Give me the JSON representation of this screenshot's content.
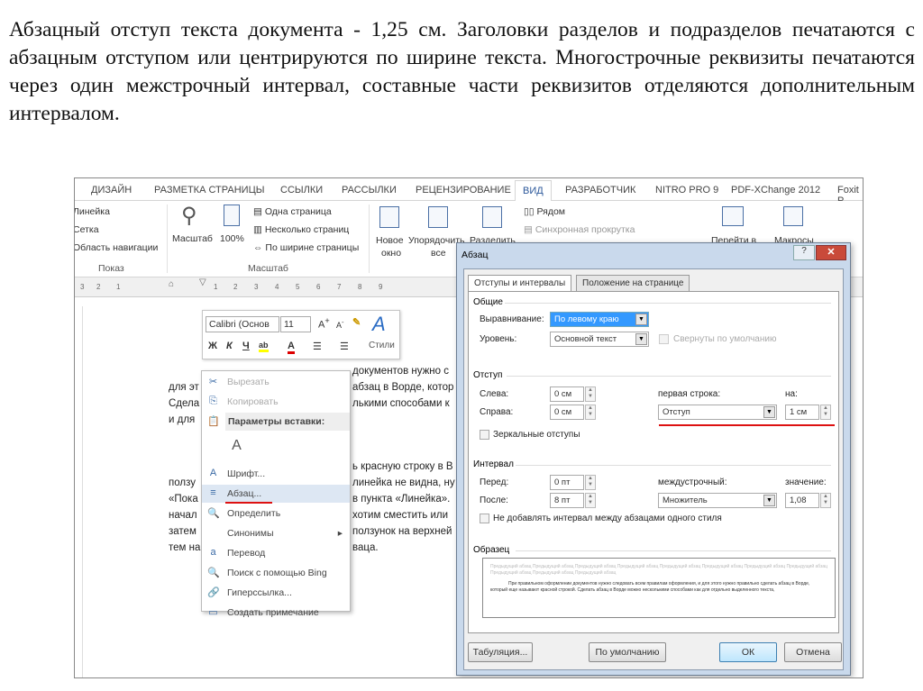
{
  "intro_text": "Абзацный отступ текста документа - 1,25 см. Заголовки разделов и подразделов печатаются с абзацным отступом или центрируются по ширине текста. Многострочные реквизиты печатаются через один межстрочный интервал, составные части реквизитов отделяются дополнительным интервалом.",
  "ribbon": {
    "tabs": [
      "ДИЗАЙН",
      "РАЗМЕТКА СТРАНИЦЫ",
      "ССЫЛКИ",
      "РАССЫЛКИ",
      "РЕЦЕНЗИРОВАНИЕ",
      "ВИД",
      "РАЗРАБОТЧИК",
      "NITRO PRO 9",
      "PDF-XChange 2012",
      "Foxit P"
    ],
    "active_tab": "ВИД",
    "show": {
      "items": [
        "Линейка",
        "Сетка",
        "Область навигации"
      ],
      "group": "Показ"
    },
    "zoom": {
      "zoom": "Масштаб",
      "percent": "100%",
      "one_page": "Одна страница",
      "multi_page": "Несколько страниц",
      "page_width": "По ширине страницы",
      "group": "Масштаб"
    },
    "window": {
      "new_window": "Новое",
      "new_window2": "окно",
      "arrange": "Упорядочить",
      "arrange2": "все",
      "split": "Разделить",
      "side_by_side": "Рядом",
      "sync_scroll": "Синхронная прокрутка",
      "switch": "Перейти в",
      "macros": "Макросы"
    }
  },
  "ruler": [
    "3",
    "2",
    "1",
    "1",
    "2",
    "3",
    "4",
    "5",
    "6",
    "7",
    "8",
    "9"
  ],
  "document": {
    "lines": [
      {
        "left": "",
        "right": "документов нужно с"
      },
      {
        "left": "для эт",
        "right": "абзац в Ворде, котор"
      },
      {
        "left": "Сдела",
        "right": "лькими способами к"
      },
      {
        "left": "и для",
        "right": ""
      },
      {
        "left": "",
        "right": "ь красную строку в В"
      },
      {
        "left": "ползу",
        "right": "линейка не видна, ну"
      },
      {
        "left": "«Пока",
        "right": "в пункта «Линейка»."
      },
      {
        "left": "начал",
        "right": "хотим сместить или"
      },
      {
        "left": "затем",
        "right": "ползунок на верхней"
      },
      {
        "left": "тем на",
        "right": "ваца."
      }
    ]
  },
  "mini_toolbar": {
    "font": "Calibri (Основ",
    "size": "11",
    "bold": "Ж",
    "italic": "К",
    "underline": "Ч",
    "styles": "Стили"
  },
  "context_menu": [
    {
      "label": "Вырезать",
      "icon": "✂",
      "state": "disabled"
    },
    {
      "label": "Копировать",
      "icon": "⎘",
      "state": "disabled"
    },
    {
      "label": "Параметры вставки:",
      "icon": "📋",
      "state": "header"
    },
    {
      "label": "",
      "icon": "A",
      "state": "paste"
    },
    {
      "label": "Шрифт...",
      "icon": "A",
      "state": ""
    },
    {
      "label": "Абзац...",
      "icon": "≡",
      "state": "highlight"
    },
    {
      "label": "Определить",
      "icon": "🔍",
      "state": ""
    },
    {
      "label": "Синонимы",
      "icon": "",
      "state": "submenu"
    },
    {
      "label": "Перевод",
      "icon": "a",
      "state": ""
    },
    {
      "label": "Поиск с помощью Bing",
      "icon": "🔍",
      "state": ""
    },
    {
      "label": "Гиперссылка...",
      "icon": "🔗",
      "state": ""
    },
    {
      "label": "Создать примечание",
      "icon": "▭",
      "state": ""
    }
  ],
  "dialog": {
    "title": "Абзац",
    "help": "?",
    "close": "✕",
    "tabs": [
      "Отступы и интервалы",
      "Положение на странице"
    ],
    "general": {
      "title": "Общие",
      "alignment_label": "Выравнивание:",
      "alignment": "По левому краю",
      "level_label": "Уровень:",
      "level": "Основной текст",
      "collapsed": "Свернуты по умолчанию"
    },
    "indent": {
      "title": "Отступ",
      "left_label": "Слева:",
      "left": "0 см",
      "right_label": "Справа:",
      "right": "0 см",
      "first_label": "первая строка:",
      "first": "Отступ",
      "by_label": "на:",
      "by": "1 см",
      "mirror": "Зеркальные отступы"
    },
    "spacing": {
      "title": "Интервал",
      "before_label": "Перед:",
      "before": "0 пт",
      "after_label": "После:",
      "after": "8 пт",
      "line_label": "междустрочный:",
      "line": "Множитель",
      "value_label": "значение:",
      "value": "1,08",
      "no_add": "Не добавлять интервал между абзацами одного стиля"
    },
    "preview": {
      "title": "Образец",
      "prev": "Предыдущий абзац Предыдущий абзац Предыдущий абзац Предыдущий абзац Предыдущий абзац Предыдущий абзац Предыдущий абзац Предыдущий абзац Предыдущий абзац Предыдущий абзац Предыдущий абзац",
      "sample": "При правильном оформлении документов нужно следовать всем правилам оформления, и для этого нужно правильно сделать абзац в Ворде, который еще называют красной строкой. Сделать абзац в Ворде можно несколькими способами как для отдельно выделенного текста,"
    },
    "buttons": {
      "tabs": "Табуляция...",
      "default": "По умолчанию",
      "ok": "ОК",
      "cancel": "Отмена"
    }
  }
}
